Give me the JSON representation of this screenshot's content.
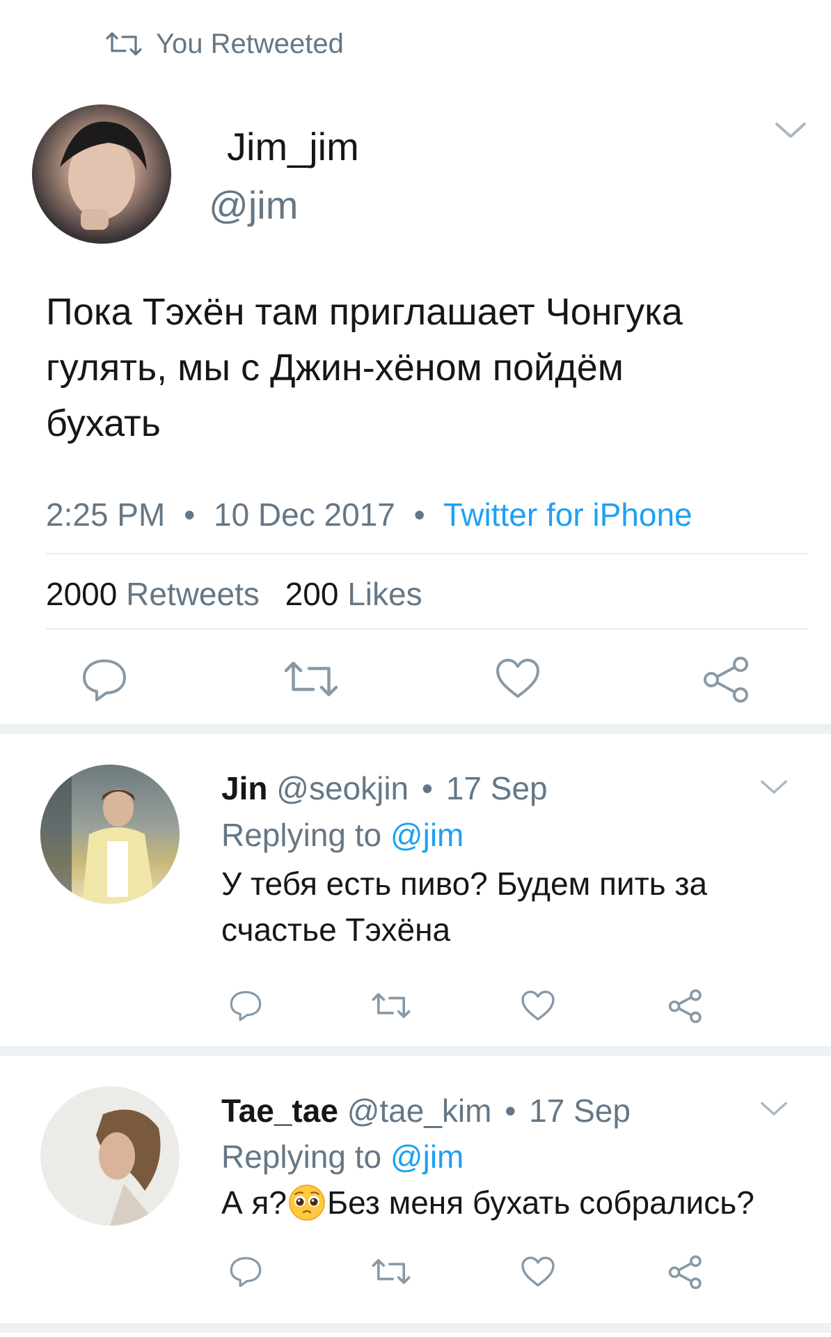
{
  "retweet_banner": {
    "icon": "retweet-icon",
    "text": "You Retweeted"
  },
  "main_tweet": {
    "display_name": "Jim_jim",
    "handle": "@jim",
    "text_lines": [
      "Пока Тэхён там приглашает Чонгука",
      "гулять, мы с Джин-хёном пойдём",
      "бухать"
    ],
    "time": "2:25 PM",
    "dot": "•",
    "date": "10 Dec 2017",
    "source": "Twitter for iPhone",
    "retweets_count": "2000",
    "retweets_label": "Retweets",
    "likes_count": "200",
    "likes_label": "Likes",
    "actions": [
      "reply-icon",
      "retweet-icon",
      "like-icon",
      "share-icon"
    ]
  },
  "replies": [
    {
      "name": "Jin",
      "handle": "@seokjin",
      "dot": "•",
      "date": "17 Sep",
      "replying_label": "Replying to",
      "replying_to": "@jim",
      "text_lines": [
        "У тебя есть пиво? Будем пить за",
        "счастье Тэхёна"
      ]
    },
    {
      "name": "Tae_tae",
      "handle": "@tae_kim",
      "dot": "•",
      "date": "17 Sep",
      "replying_label": "Replying to",
      "replying_to": "@jim",
      "text_before_emoji": "А я?",
      "emoji": "pleading-face-emoji",
      "text_after_emoji": "Без меня бухать собрались?"
    }
  ],
  "colors": {
    "accent": "#1da1f2",
    "muted": "#657786",
    "text": "#14171a",
    "divider": "#e6ecf0"
  }
}
